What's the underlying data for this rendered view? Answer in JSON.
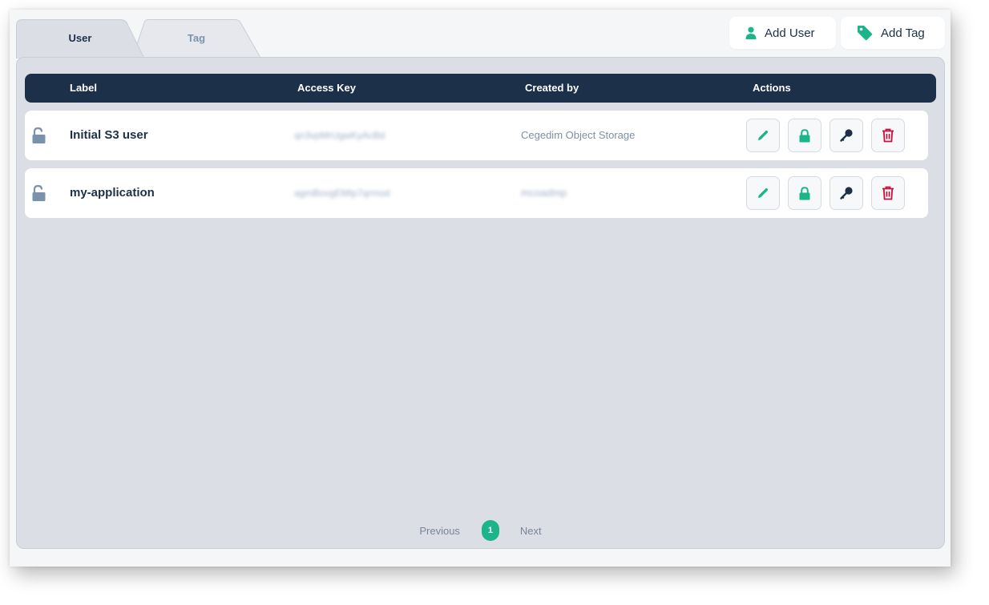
{
  "tabs": [
    {
      "label": "User",
      "active": true
    },
    {
      "label": "Tag",
      "active": false
    }
  ],
  "toolbar": {
    "add_user_label": "Add User",
    "add_tag_label": "Add Tag"
  },
  "table": {
    "columns": [
      "Label",
      "Access Key",
      "Created by",
      "Actions"
    ],
    "rows": [
      {
        "label": "Initial S3 user",
        "access_key": "qn3vpMrUgwKyAcBd",
        "created_by": "Cegedim Object Storage"
      },
      {
        "label": "my-application",
        "access_key": "agmBovgEMIp7qrmod",
        "created_by": "mcoadmp"
      }
    ]
  },
  "pagination": {
    "previous_label": "Previous",
    "current_page": "1",
    "next_label": "Next"
  },
  "colors": {
    "navy": "#1c3049",
    "accent_green": "#1ab589",
    "danger_red": "#c8103e",
    "muted_blue": "#7a93ad"
  }
}
